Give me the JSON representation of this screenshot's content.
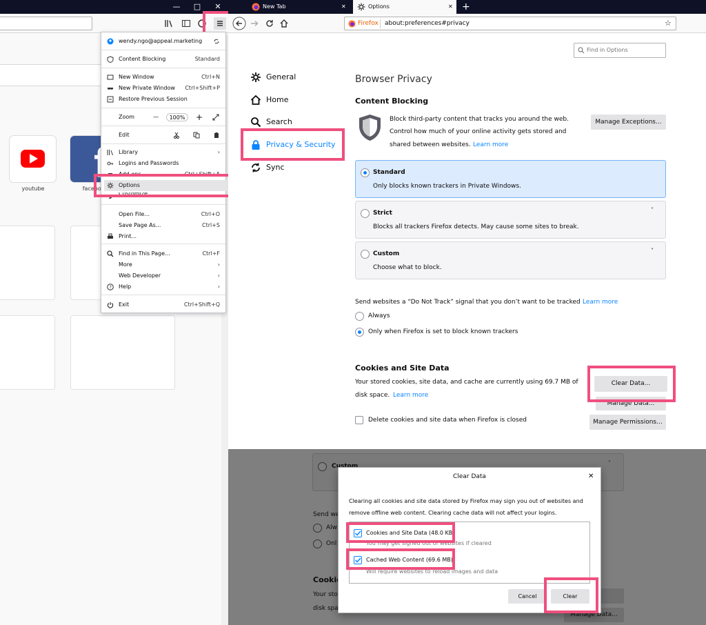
{
  "left_window": {
    "minimize_glyph": "—",
    "maximize_glyph": "□",
    "close_glyph": "✕",
    "tiles": [
      {
        "label": "youtube",
        "icon": "youtube-icon",
        "color": "#ff0000"
      },
      {
        "label": "facebook",
        "icon": "facebook-icon",
        "color": "#3b5998"
      }
    ],
    "menu": {
      "account": "wendy.ngo@appeal.marketing",
      "content_blocking": {
        "label": "Content Blocking",
        "value": "Standard"
      },
      "new_window": {
        "label": "New Window",
        "shortcut": "Ctrl+N"
      },
      "new_private_window": {
        "label": "New Private Window",
        "shortcut": "Ctrl+Shift+P"
      },
      "restore_session": {
        "label": "Restore Previous Session"
      },
      "zoom": {
        "label": "Zoom",
        "minus": "—",
        "value": "100%",
        "plus": "+"
      },
      "edit": {
        "label": "Edit"
      },
      "library": {
        "label": "Library"
      },
      "logins": {
        "label": "Logins and Passwords"
      },
      "addons": {
        "label": "Add-ons",
        "shortcut": "Ctrl+Shift+A"
      },
      "options": {
        "label": "Options"
      },
      "customize": {
        "label": "Customize..."
      },
      "open_file": {
        "label": "Open File...",
        "shortcut": "Ctrl+O"
      },
      "save_page": {
        "label": "Save Page As...",
        "shortcut": "Ctrl+S"
      },
      "print": {
        "label": "Print..."
      },
      "find": {
        "label": "Find in This Page...",
        "shortcut": "Ctrl+F"
      },
      "more": {
        "label": "More"
      },
      "web_developer": {
        "label": "Web Developer"
      },
      "help": {
        "label": "Help"
      },
      "exit": {
        "label": "Exit",
        "shortcut": "Ctrl+Shift+Q"
      }
    }
  },
  "right_window": {
    "tabs": [
      {
        "label": "New Tab"
      },
      {
        "label": "Options"
      }
    ],
    "url": {
      "identity": "Firefox",
      "address": "about:preferences#privacy"
    },
    "find_placeholder": "Find in Options",
    "categories": [
      {
        "label": "General",
        "icon": "gear-icon"
      },
      {
        "label": "Home",
        "icon": "home-icon"
      },
      {
        "label": "Search",
        "icon": "search-icon"
      },
      {
        "label": "Privacy & Security",
        "icon": "lock-icon"
      },
      {
        "label": "Sync",
        "icon": "sync-icon"
      }
    ],
    "privacy": {
      "heading": "Browser Privacy",
      "content_blocking_heading": "Content Blocking",
      "desc_line1": "Block third-party content that tracks you around the web.",
      "desc_line2": "Control how much of your online activity gets stored and",
      "desc_line3": "shared between websites.",
      "learn_more": "Learn more",
      "manage_exceptions": "Manage Exceptions...",
      "options": [
        {
          "title": "Standard",
          "desc": "Only blocks known trackers in Private Windows."
        },
        {
          "title": "Strict",
          "desc": "Blocks all trackers Firefox detects. May cause some sites to break."
        },
        {
          "title": "Custom",
          "desc": "Choose what to block."
        }
      ],
      "dnt_label": "Send websites a “Do Not Track” signal that you don’t want to be tracked",
      "dnt_learn_more": "Learn more",
      "dnt_always": "Always",
      "dnt_only": "Only when Firefox is set to block known trackers",
      "cookies_heading": "Cookies and Site Data",
      "cookies_line1": "Your stored cookies, site data, and cache are currently using 69.7 MB of",
      "cookies_line2": "disk space.",
      "cookies_learn_more": "Learn more",
      "clear_data": "Clear Data...",
      "manage_data": "Manage Data...",
      "manage_permissions": "Manage Permissions...",
      "delete_on_close": "Delete cookies and site data when Firefox is closed"
    }
  },
  "dim_background": {
    "custom": "Custom",
    "send_fragment": "Send we",
    "always_fragment": "Alw",
    "only_fragment": "Onl",
    "cookies_fragment": "Cookie",
    "your_fragment": "Your sto",
    "disk_fragment": "disk spa",
    "manage_data_fragment": "Manage Data..."
  },
  "dialog": {
    "title": "Clear Data",
    "close_glyph": "✕",
    "intro_line1": "Clearing all cookies and site data stored by Firefox may sign you out of websites and",
    "intro_line2": "remove offline web content. Clearing cache data will not affect your logins.",
    "cookies_option": "Cookies and Site Data (48.0 KB)",
    "cookies_note": "You may get signed out of websites if cleared",
    "cache_option": "Cached Web Content (69.6 MB)",
    "cache_note": "Will require websites to reload images and data",
    "cancel": "Cancel",
    "clear": "Clear"
  },
  "colors": {
    "highlight": "#ef4f7e",
    "accent": "#0a84ff",
    "dark_chrome": "#0f1126"
  }
}
